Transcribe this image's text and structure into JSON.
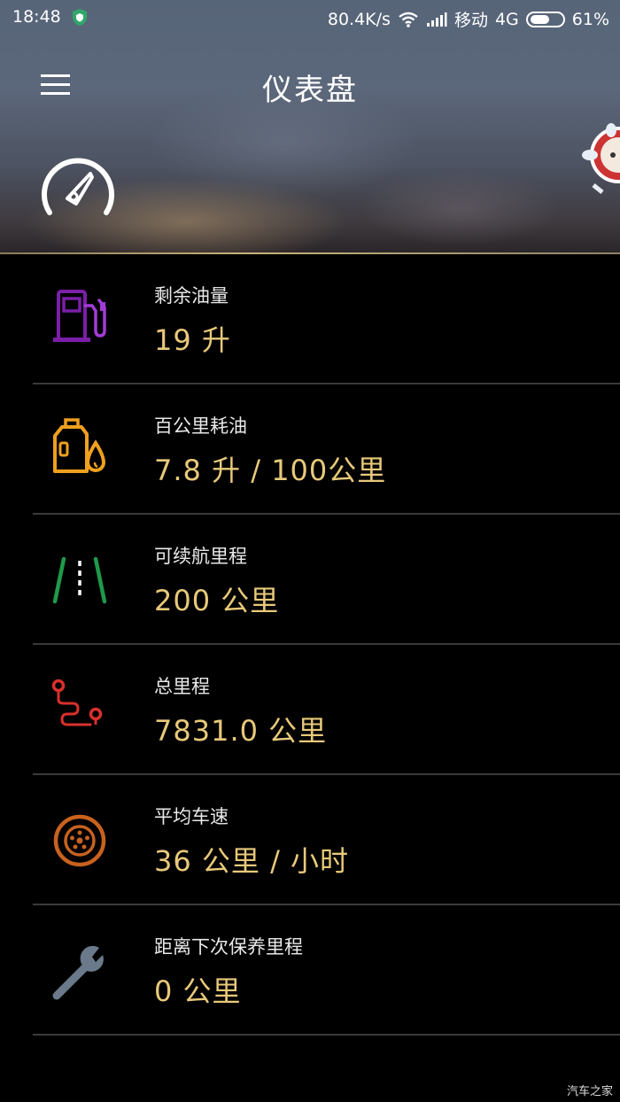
{
  "status_bar": {
    "time": "18:48",
    "net_speed": "80.4K/s",
    "carrier": "移动",
    "network": "4G",
    "battery_text": "61%",
    "battery_level": 0.61
  },
  "header": {
    "title": "仪表盘"
  },
  "items": [
    {
      "icon": "fuel-pump-icon",
      "label": "剩余油量",
      "value": "19 升",
      "color": "#7a1fa8"
    },
    {
      "icon": "oil-can-icon",
      "label": "百公里耗油",
      "value": "7.8 升 / 100公里",
      "color": "#f0a01e"
    },
    {
      "icon": "road-icon",
      "label": "可续航里程",
      "value": "200 公里",
      "color": "#1e9a4a"
    },
    {
      "icon": "route-icon",
      "label": "总里程",
      "value": "7831.0 公里",
      "color": "#d9302c"
    },
    {
      "icon": "wheel-icon",
      "label": "平均车速",
      "value": "36 公里 / 小时",
      "color": "#c8621e"
    },
    {
      "icon": "wrench-icon",
      "label": "距离下次保养里程",
      "value": "0 公里",
      "color": "#6a7a8a"
    }
  ],
  "watermark": "汽车之家"
}
